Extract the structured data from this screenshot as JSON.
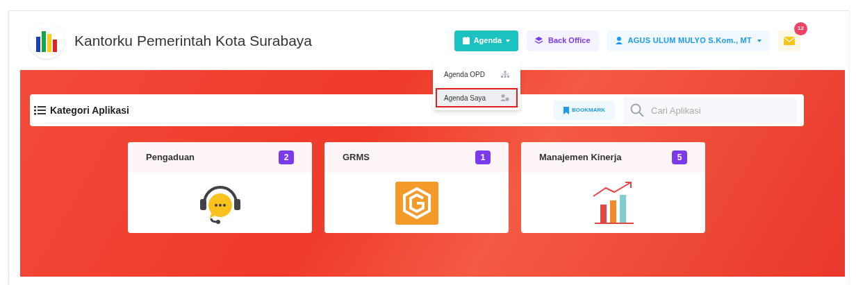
{
  "header": {
    "title": "Kantorku Pemerintah Kota Surabaya",
    "agenda_button": "Agenda",
    "back_office_button": "Back Office",
    "user_button": "AGUS ULUM MULYO S.Kom., MT",
    "mail_badge": "12"
  },
  "agenda_menu": [
    {
      "label": "Agenda OPD",
      "kind": "org",
      "selected": false
    },
    {
      "label": "Agenda Saya",
      "kind": "user",
      "selected": true
    }
  ],
  "category_bar": {
    "title": "Kategori Aplikasi",
    "bookmark_button": "BOOKMARK",
    "search": {
      "placeholder": "Cari Aplikasi"
    }
  },
  "cards": [
    {
      "title": "Pengaduan",
      "count": "2",
      "kind": "headset"
    },
    {
      "title": "GRMS",
      "count": "1",
      "kind": "grms"
    },
    {
      "title": "Manajemen Kinerja",
      "count": "5",
      "kind": "chart"
    }
  ]
}
